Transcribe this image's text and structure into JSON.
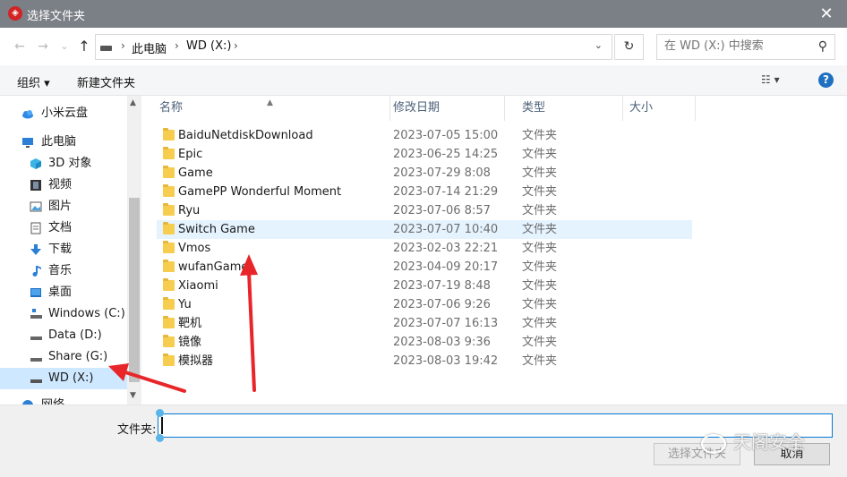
{
  "window": {
    "title": "选择文件夹",
    "close_glyph": "✕"
  },
  "nav": {
    "back_glyph": "←",
    "forward_glyph": "→",
    "recent_glyph": "⌄",
    "up_glyph": "↑"
  },
  "address": {
    "crumbs": [
      "此电脑",
      "WD (X:)"
    ],
    "separator": "›",
    "dropdown_glyph": "⌄",
    "refresh_glyph": "↻"
  },
  "search": {
    "placeholder": "在 WD (X:) 中搜索",
    "icon_glyph": "⚲"
  },
  "toolbar": {
    "organize_label": "组织 ▾",
    "new_folder_label": "新建文件夹",
    "view_glyph": "☷ ▾",
    "help_glyph": "?"
  },
  "sidebar": {
    "items": [
      {
        "label": "小米云盘",
        "icon": "cloud-icon"
      },
      {
        "label": "此电脑",
        "icon": "computer-icon"
      },
      {
        "label": "3D 对象",
        "icon": "cube-icon"
      },
      {
        "label": "视频",
        "icon": "film-icon"
      },
      {
        "label": "图片",
        "icon": "picture-icon"
      },
      {
        "label": "文档",
        "icon": "document-icon"
      },
      {
        "label": "下载",
        "icon": "download-icon"
      },
      {
        "label": "音乐",
        "icon": "music-icon"
      },
      {
        "label": "桌面",
        "icon": "desktop-icon"
      },
      {
        "label": "Windows (C:)",
        "icon": "drive-icon"
      },
      {
        "label": "Data (D:)",
        "icon": "drive-icon"
      },
      {
        "label": "Share (G:)",
        "icon": "drive-icon"
      },
      {
        "label": "WD (X:)",
        "icon": "drive-icon"
      },
      {
        "label": "网络",
        "icon": "network-icon"
      }
    ],
    "selected_index": 12
  },
  "columns": {
    "name": "名称",
    "modified": "修改日期",
    "type": "类型",
    "size": "大小"
  },
  "files": [
    {
      "name": "BaiduNetdiskDownload",
      "modified": "2023-07-05 15:00",
      "type": "文件夹"
    },
    {
      "name": "Epic",
      "modified": "2023-06-25 14:25",
      "type": "文件夹"
    },
    {
      "name": "Game",
      "modified": "2023-07-29 8:08",
      "type": "文件夹"
    },
    {
      "name": "GamePP Wonderful Moment",
      "modified": "2023-07-14 21:29",
      "type": "文件夹"
    },
    {
      "name": "Ryu",
      "modified": "2023-07-06 8:57",
      "type": "文件夹"
    },
    {
      "name": "Switch Game",
      "modified": "2023-07-07 10:40",
      "type": "文件夹"
    },
    {
      "name": "Vmos",
      "modified": "2023-02-03 22:21",
      "type": "文件夹"
    },
    {
      "name": "wufanGame",
      "modified": "2023-04-09 20:17",
      "type": "文件夹"
    },
    {
      "name": "Xiaomi",
      "modified": "2023-07-19 8:48",
      "type": "文件夹"
    },
    {
      "name": "Yu",
      "modified": "2023-07-06 9:26",
      "type": "文件夹"
    },
    {
      "name": "靶机",
      "modified": "2023-07-07 16:13",
      "type": "文件夹"
    },
    {
      "name": "镜像",
      "modified": "2023-08-03 9:36",
      "type": "文件夹"
    },
    {
      "name": "模拟器",
      "modified": "2023-08-03 19:42",
      "type": "文件夹"
    }
  ],
  "hovered_index": 5,
  "footer": {
    "folder_label": "文件夹:",
    "folder_value": "",
    "select_button": "选择文件夹",
    "cancel_button": "取消"
  },
  "watermark": {
    "text": "天阁安全"
  },
  "colors": {
    "titlebar": "#7b7f86",
    "selection": "#cde8ff",
    "hover": "#e5f3ff",
    "annotation_arrow": "#e8262a",
    "accent": "#0078d7"
  }
}
